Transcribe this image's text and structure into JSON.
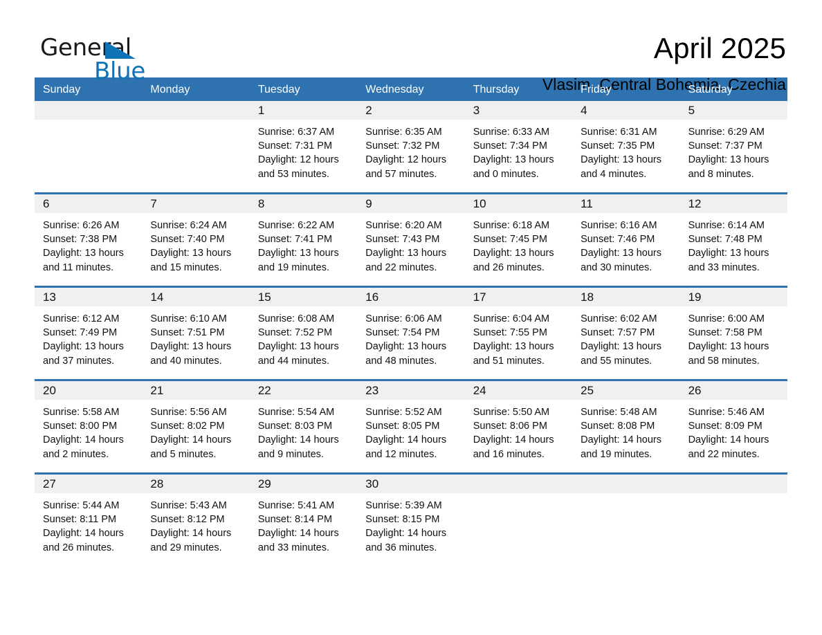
{
  "brand": {
    "logo_text_primary": "General",
    "logo_text_secondary": "Blue",
    "logo_accent_color": "#1073b8",
    "triangle_icon_name": "blue-triangle-icon"
  },
  "header": {
    "title": "April 2025",
    "subtitle": "Vlasim, Central Bohemia, Czechia"
  },
  "theme": {
    "header_blue": "#2e73b0",
    "date_band_gray": "#f0f0f0",
    "text_color": "#111111"
  },
  "weekdays": [
    "Sunday",
    "Monday",
    "Tuesday",
    "Wednesday",
    "Thursday",
    "Friday",
    "Saturday"
  ],
  "weeks": [
    [
      {
        "day": "",
        "sunrise": "",
        "sunset": "",
        "daylight_line1": "",
        "daylight_line2": "",
        "blank": true
      },
      {
        "day": "",
        "sunrise": "",
        "sunset": "",
        "daylight_line1": "",
        "daylight_line2": "",
        "blank": true
      },
      {
        "day": "1",
        "sunrise": "Sunrise: 6:37 AM",
        "sunset": "Sunset: 7:31 PM",
        "daylight_line1": "Daylight: 12 hours",
        "daylight_line2": "and 53 minutes."
      },
      {
        "day": "2",
        "sunrise": "Sunrise: 6:35 AM",
        "sunset": "Sunset: 7:32 PM",
        "daylight_line1": "Daylight: 12 hours",
        "daylight_line2": "and 57 minutes."
      },
      {
        "day": "3",
        "sunrise": "Sunrise: 6:33 AM",
        "sunset": "Sunset: 7:34 PM",
        "daylight_line1": "Daylight: 13 hours",
        "daylight_line2": "and 0 minutes."
      },
      {
        "day": "4",
        "sunrise": "Sunrise: 6:31 AM",
        "sunset": "Sunset: 7:35 PM",
        "daylight_line1": "Daylight: 13 hours",
        "daylight_line2": "and 4 minutes."
      },
      {
        "day": "5",
        "sunrise": "Sunrise: 6:29 AM",
        "sunset": "Sunset: 7:37 PM",
        "daylight_line1": "Daylight: 13 hours",
        "daylight_line2": "and 8 minutes."
      }
    ],
    [
      {
        "day": "6",
        "sunrise": "Sunrise: 6:26 AM",
        "sunset": "Sunset: 7:38 PM",
        "daylight_line1": "Daylight: 13 hours",
        "daylight_line2": "and 11 minutes."
      },
      {
        "day": "7",
        "sunrise": "Sunrise: 6:24 AM",
        "sunset": "Sunset: 7:40 PM",
        "daylight_line1": "Daylight: 13 hours",
        "daylight_line2": "and 15 minutes."
      },
      {
        "day": "8",
        "sunrise": "Sunrise: 6:22 AM",
        "sunset": "Sunset: 7:41 PM",
        "daylight_line1": "Daylight: 13 hours",
        "daylight_line2": "and 19 minutes."
      },
      {
        "day": "9",
        "sunrise": "Sunrise: 6:20 AM",
        "sunset": "Sunset: 7:43 PM",
        "daylight_line1": "Daylight: 13 hours",
        "daylight_line2": "and 22 minutes."
      },
      {
        "day": "10",
        "sunrise": "Sunrise: 6:18 AM",
        "sunset": "Sunset: 7:45 PM",
        "daylight_line1": "Daylight: 13 hours",
        "daylight_line2": "and 26 minutes."
      },
      {
        "day": "11",
        "sunrise": "Sunrise: 6:16 AM",
        "sunset": "Sunset: 7:46 PM",
        "daylight_line1": "Daylight: 13 hours",
        "daylight_line2": "and 30 minutes."
      },
      {
        "day": "12",
        "sunrise": "Sunrise: 6:14 AM",
        "sunset": "Sunset: 7:48 PM",
        "daylight_line1": "Daylight: 13 hours",
        "daylight_line2": "and 33 minutes."
      }
    ],
    [
      {
        "day": "13",
        "sunrise": "Sunrise: 6:12 AM",
        "sunset": "Sunset: 7:49 PM",
        "daylight_line1": "Daylight: 13 hours",
        "daylight_line2": "and 37 minutes."
      },
      {
        "day": "14",
        "sunrise": "Sunrise: 6:10 AM",
        "sunset": "Sunset: 7:51 PM",
        "daylight_line1": "Daylight: 13 hours",
        "daylight_line2": "and 40 minutes."
      },
      {
        "day": "15",
        "sunrise": "Sunrise: 6:08 AM",
        "sunset": "Sunset: 7:52 PM",
        "daylight_line1": "Daylight: 13 hours",
        "daylight_line2": "and 44 minutes."
      },
      {
        "day": "16",
        "sunrise": "Sunrise: 6:06 AM",
        "sunset": "Sunset: 7:54 PM",
        "daylight_line1": "Daylight: 13 hours",
        "daylight_line2": "and 48 minutes."
      },
      {
        "day": "17",
        "sunrise": "Sunrise: 6:04 AM",
        "sunset": "Sunset: 7:55 PM",
        "daylight_line1": "Daylight: 13 hours",
        "daylight_line2": "and 51 minutes."
      },
      {
        "day": "18",
        "sunrise": "Sunrise: 6:02 AM",
        "sunset": "Sunset: 7:57 PM",
        "daylight_line1": "Daylight: 13 hours",
        "daylight_line2": "and 55 minutes."
      },
      {
        "day": "19",
        "sunrise": "Sunrise: 6:00 AM",
        "sunset": "Sunset: 7:58 PM",
        "daylight_line1": "Daylight: 13 hours",
        "daylight_line2": "and 58 minutes."
      }
    ],
    [
      {
        "day": "20",
        "sunrise": "Sunrise: 5:58 AM",
        "sunset": "Sunset: 8:00 PM",
        "daylight_line1": "Daylight: 14 hours",
        "daylight_line2": "and 2 minutes."
      },
      {
        "day": "21",
        "sunrise": "Sunrise: 5:56 AM",
        "sunset": "Sunset: 8:02 PM",
        "daylight_line1": "Daylight: 14 hours",
        "daylight_line2": "and 5 minutes."
      },
      {
        "day": "22",
        "sunrise": "Sunrise: 5:54 AM",
        "sunset": "Sunset: 8:03 PM",
        "daylight_line1": "Daylight: 14 hours",
        "daylight_line2": "and 9 minutes."
      },
      {
        "day": "23",
        "sunrise": "Sunrise: 5:52 AM",
        "sunset": "Sunset: 8:05 PM",
        "daylight_line1": "Daylight: 14 hours",
        "daylight_line2": "and 12 minutes."
      },
      {
        "day": "24",
        "sunrise": "Sunrise: 5:50 AM",
        "sunset": "Sunset: 8:06 PM",
        "daylight_line1": "Daylight: 14 hours",
        "daylight_line2": "and 16 minutes."
      },
      {
        "day": "25",
        "sunrise": "Sunrise: 5:48 AM",
        "sunset": "Sunset: 8:08 PM",
        "daylight_line1": "Daylight: 14 hours",
        "daylight_line2": "and 19 minutes."
      },
      {
        "day": "26",
        "sunrise": "Sunrise: 5:46 AM",
        "sunset": "Sunset: 8:09 PM",
        "daylight_line1": "Daylight: 14 hours",
        "daylight_line2": "and 22 minutes."
      }
    ],
    [
      {
        "day": "27",
        "sunrise": "Sunrise: 5:44 AM",
        "sunset": "Sunset: 8:11 PM",
        "daylight_line1": "Daylight: 14 hours",
        "daylight_line2": "and 26 minutes."
      },
      {
        "day": "28",
        "sunrise": "Sunrise: 5:43 AM",
        "sunset": "Sunset: 8:12 PM",
        "daylight_line1": "Daylight: 14 hours",
        "daylight_line2": "and 29 minutes."
      },
      {
        "day": "29",
        "sunrise": "Sunrise: 5:41 AM",
        "sunset": "Sunset: 8:14 PM",
        "daylight_line1": "Daylight: 14 hours",
        "daylight_line2": "and 33 minutes."
      },
      {
        "day": "30",
        "sunrise": "Sunrise: 5:39 AM",
        "sunset": "Sunset: 8:15 PM",
        "daylight_line1": "Daylight: 14 hours",
        "daylight_line2": "and 36 minutes."
      },
      {
        "day": "",
        "sunrise": "",
        "sunset": "",
        "daylight_line1": "",
        "daylight_line2": "",
        "noday": true
      },
      {
        "day": "",
        "sunrise": "",
        "sunset": "",
        "daylight_line1": "",
        "daylight_line2": "",
        "noday": true
      },
      {
        "day": "",
        "sunrise": "",
        "sunset": "",
        "daylight_line1": "",
        "daylight_line2": "",
        "noday": true
      }
    ]
  ]
}
